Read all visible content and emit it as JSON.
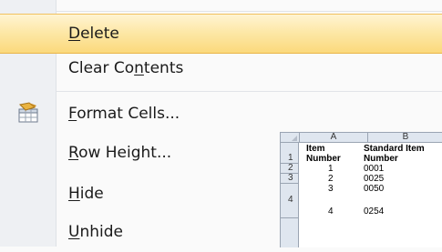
{
  "context_menu": {
    "items": [
      {
        "before": "",
        "key": "D",
        "after": "elete",
        "highlighted": true
      },
      {
        "before": "Clear Co",
        "key": "n",
        "after": "tents",
        "highlighted": false
      },
      {
        "before": "",
        "key": "F",
        "after": "ormat Cells...",
        "highlighted": false,
        "icon": "format-cells-icon"
      },
      {
        "before": "",
        "key": "R",
        "after": "ow Height...",
        "highlighted": false
      },
      {
        "before": "",
        "key": "H",
        "after": "ide",
        "highlighted": false
      },
      {
        "before": "",
        "key": "U",
        "after": "nhide",
        "highlighted": false
      }
    ]
  },
  "sheet": {
    "columns": [
      "A",
      "B"
    ],
    "row_numbers": [
      "1",
      "2",
      "3",
      "4"
    ],
    "header": {
      "a_line1": "Item",
      "a_line2": "Number",
      "b_line1": "Standard Item",
      "b_line2": "Number"
    },
    "rows": [
      {
        "a": "1",
        "b": "0001"
      },
      {
        "a": "2",
        "b": "0025"
      },
      {
        "a": "3",
        "b": "0050"
      },
      {
        "a": "4",
        "b": "0254"
      }
    ]
  },
  "colors": {
    "highlight": "#fde8a8",
    "gutter": "#eef0f3",
    "sheet_header": "#dfe6ef"
  }
}
